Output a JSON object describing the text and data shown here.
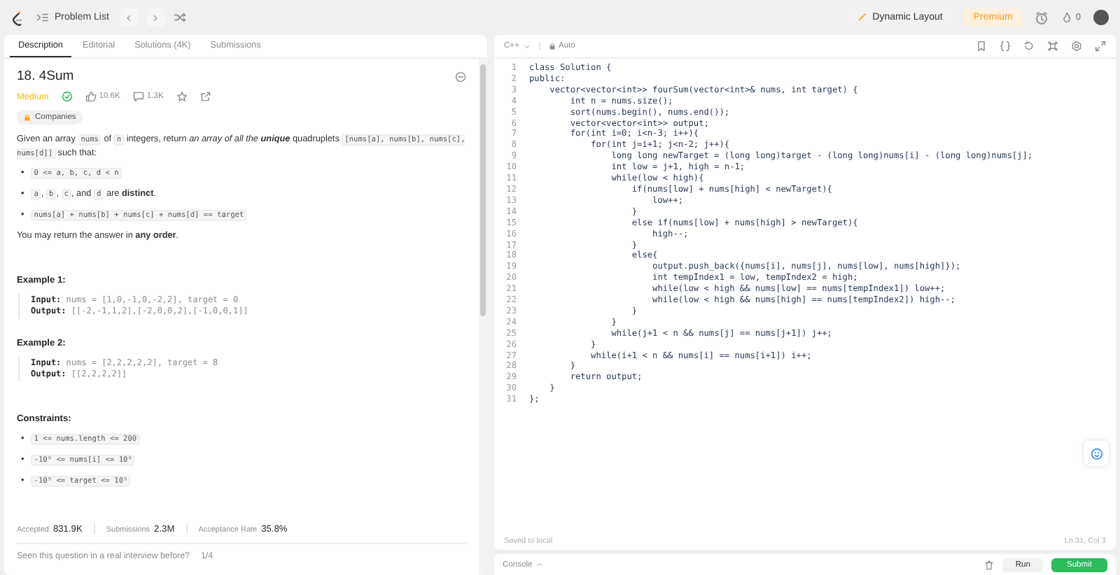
{
  "topbar": {
    "problem_list": "Problem List",
    "dynamic_layout": "Dynamic Layout",
    "premium": "Premium",
    "streak": "0"
  },
  "tabs": [
    {
      "label": "Description",
      "selected": true
    },
    {
      "label": "Editorial",
      "selected": false
    },
    {
      "label": "Solutions (4K)",
      "selected": false
    },
    {
      "label": "Submissions",
      "selected": false
    }
  ],
  "problem": {
    "title": "18. 4Sum",
    "difficulty": "Medium",
    "solved": true,
    "likes": "10.6K",
    "dislikes": "1.3K",
    "companies": "Companies",
    "statement": [
      {
        "kind": "text",
        "text": "Given an array "
      },
      {
        "kind": "code",
        "text": "nums"
      },
      {
        "kind": "text",
        "text": " of "
      },
      {
        "kind": "code",
        "text": "n"
      },
      {
        "kind": "text",
        "text": " integers, return "
      },
      {
        "kind": "italic",
        "text": "an array of all the "
      },
      {
        "kind": "bold_italic",
        "text": "unique"
      },
      {
        "kind": "text",
        "text": " quadruplets "
      },
      {
        "kind": "code",
        "text": "[nums[a], nums[b], nums[c], nums[d]]"
      },
      {
        "kind": "text",
        "text": " such that:"
      }
    ],
    "bullet_marker": "•",
    "bullets": [
      [
        {
          "kind": "code",
          "text": "0 <= a, b, c, d < n"
        }
      ],
      [
        {
          "kind": "code",
          "text": "a"
        },
        {
          "kind": "text",
          "text": ", "
        },
        {
          "kind": "code",
          "text": "b"
        },
        {
          "kind": "text",
          "text": ", "
        },
        {
          "kind": "code",
          "text": "c"
        },
        {
          "kind": "text",
          "text": ", and "
        },
        {
          "kind": "code",
          "text": "d"
        },
        {
          "kind": "text",
          "text": " are "
        },
        {
          "kind": "bold",
          "text": "distinct"
        },
        {
          "kind": "text",
          "text": "."
        }
      ],
      [
        {
          "kind": "code",
          "text": "nums[a] + nums[b] + nums[c] + nums[d] == target"
        }
      ]
    ],
    "closing": [
      {
        "kind": "text",
        "text": "You may return the answer in "
      },
      {
        "kind": "bold",
        "text": "any order"
      },
      {
        "kind": "text",
        "text": "."
      }
    ],
    "examples": [
      {
        "heading": "Example 1:",
        "input_label": "Input:",
        "input": "nums = [1,0,-1,0,-2,2], target = 0",
        "output_label": "Output:",
        "output": "[[-2,-1,1,2],[-2,0,0,2],[-1,0,0,1]]"
      },
      {
        "heading": "Example 2:",
        "input_label": "Input:",
        "input": "nums = [2,2,2,2,2], target = 8",
        "output_label": "Output:",
        "output": "[[2,2,2,2]]"
      }
    ],
    "constraints_heading": "Constraints:",
    "constraints": [
      "1 <= nums.length <= 200",
      "-10⁹ <= nums[i] <= 10⁹",
      "-10⁹ <= target <= 10⁹"
    ],
    "stats": [
      {
        "label": "Accepted",
        "value": "831.9K"
      },
      {
        "label": "Submissions",
        "value": "2.3M"
      },
      {
        "label": "Acceptance Rate",
        "value": "35.8%"
      }
    ],
    "interview_prompt": "Seen this question in a real interview before?",
    "interview_page": "1/4"
  },
  "editor": {
    "language": "C++",
    "mode": "Auto",
    "lines": [
      {
        "n": "1",
        "code": "class Solution {"
      },
      {
        "n": "2",
        "code": "public:"
      },
      {
        "n": "3",
        "code": "    vector<vector<int>> fourSum(vector<int>& nums, int target) {"
      },
      {
        "n": "4",
        "code": "        int n = nums.size();"
      },
      {
        "n": "5",
        "code": "        sort(nums.begin(), nums.end());"
      },
      {
        "n": "6",
        "code": "        vector<vector<int>> output;"
      },
      {
        "n": "7",
        "code": "        for(int i=0; i<n-3; i++){"
      },
      {
        "n": "8",
        "code": "            for(int j=i+1; j<n-2; j++){"
      },
      {
        "n": "9",
        "code": "                long long newTarget = (long long)target - (long long)nums[i] - (long long)nums[j];"
      },
      {
        "n": "10",
        "code": "                int low = j+1, high = n-1;"
      },
      {
        "n": "11",
        "code": "                while(low < high){"
      },
      {
        "n": "12",
        "code": "                    if(nums[low] + nums[high] < newTarget){"
      },
      {
        "n": "13",
        "code": "                        low++;"
      },
      {
        "n": "14",
        "code": "                    }"
      },
      {
        "n": "15",
        "code": "                    else if(nums[low] + nums[high] > newTarget){"
      },
      {
        "n": "16",
        "code": "                        high--;"
      },
      {
        "n": "17",
        "code": "                    }"
      },
      {
        "n": "18",
        "code": "                    else{"
      },
      {
        "n": "19",
        "code": "                        output.push_back({nums[i], nums[j], nums[low], nums[high]});"
      },
      {
        "n": "20",
        "code": "                        int tempIndex1 = low, tempIndex2 = high;"
      },
      {
        "n": "21",
        "code": "                        while(low < high && nums[low] == nums[tempIndex1]) low++;"
      },
      {
        "n": "22",
        "code": "                        while(low < high && nums[high] == nums[tempIndex2]) high--;"
      },
      {
        "n": "23",
        "code": "                    }"
      },
      {
        "n": "24",
        "code": "                }"
      },
      {
        "n": "25",
        "code": "                while(j+1 < n && nums[j] == nums[j+1]) j++;"
      },
      {
        "n": "26",
        "code": "            }"
      },
      {
        "n": "27",
        "code": "            while(i+1 < n && nums[i] == nums[i+1]) i++;"
      },
      {
        "n": "28",
        "code": "        }"
      },
      {
        "n": "29",
        "code": "        return output;"
      },
      {
        "n": "30",
        "code": "    }"
      },
      {
        "n": "31",
        "code": "};"
      }
    ],
    "saved": "Saved to local",
    "cursor": "Ln 31, Col 3"
  },
  "console": {
    "label": "Console",
    "run": "Run",
    "submit": "Submit"
  }
}
